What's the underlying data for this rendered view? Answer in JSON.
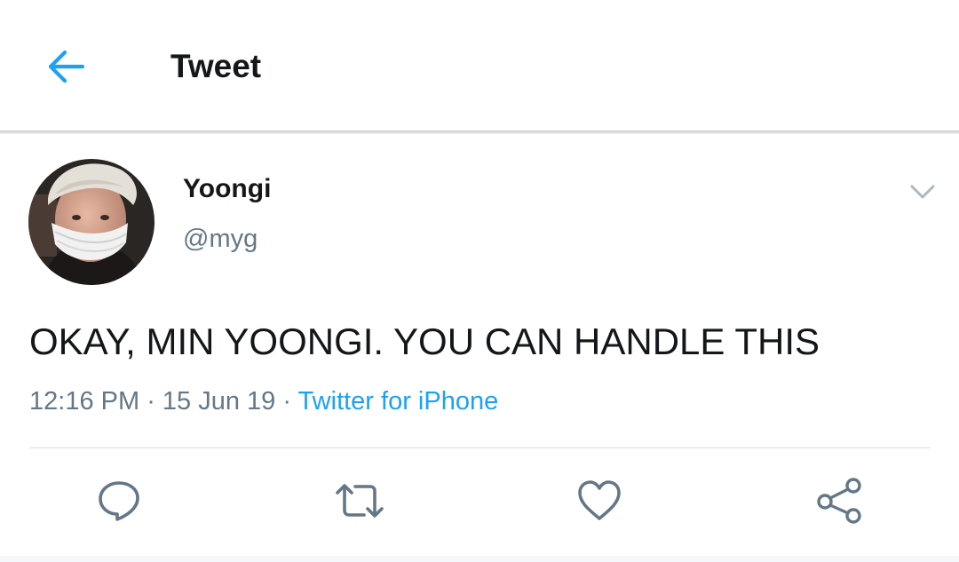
{
  "header": {
    "title": "Tweet",
    "back_icon": "arrow-left-icon"
  },
  "author": {
    "display_name": "Yoongi",
    "handle": "@myg",
    "avatar_icon": "profile-photo"
  },
  "tweet": {
    "text": "OKAY, MIN YOONGI. YOU CAN HANDLE THIS",
    "time": "12:16 PM",
    "separator": " · ",
    "date": "15 Jun 19",
    "source": "Twitter for iPhone"
  },
  "actions": [
    {
      "name": "reply",
      "icon": "speech-bubble-icon"
    },
    {
      "name": "retweet",
      "icon": "retweet-icon"
    },
    {
      "name": "like",
      "icon": "heart-icon"
    },
    {
      "name": "share",
      "icon": "share-icon"
    }
  ],
  "colors": {
    "accent": "#1da1f2",
    "text_primary": "#14171a",
    "text_secondary": "#657786",
    "icon_gray": "#657786"
  }
}
